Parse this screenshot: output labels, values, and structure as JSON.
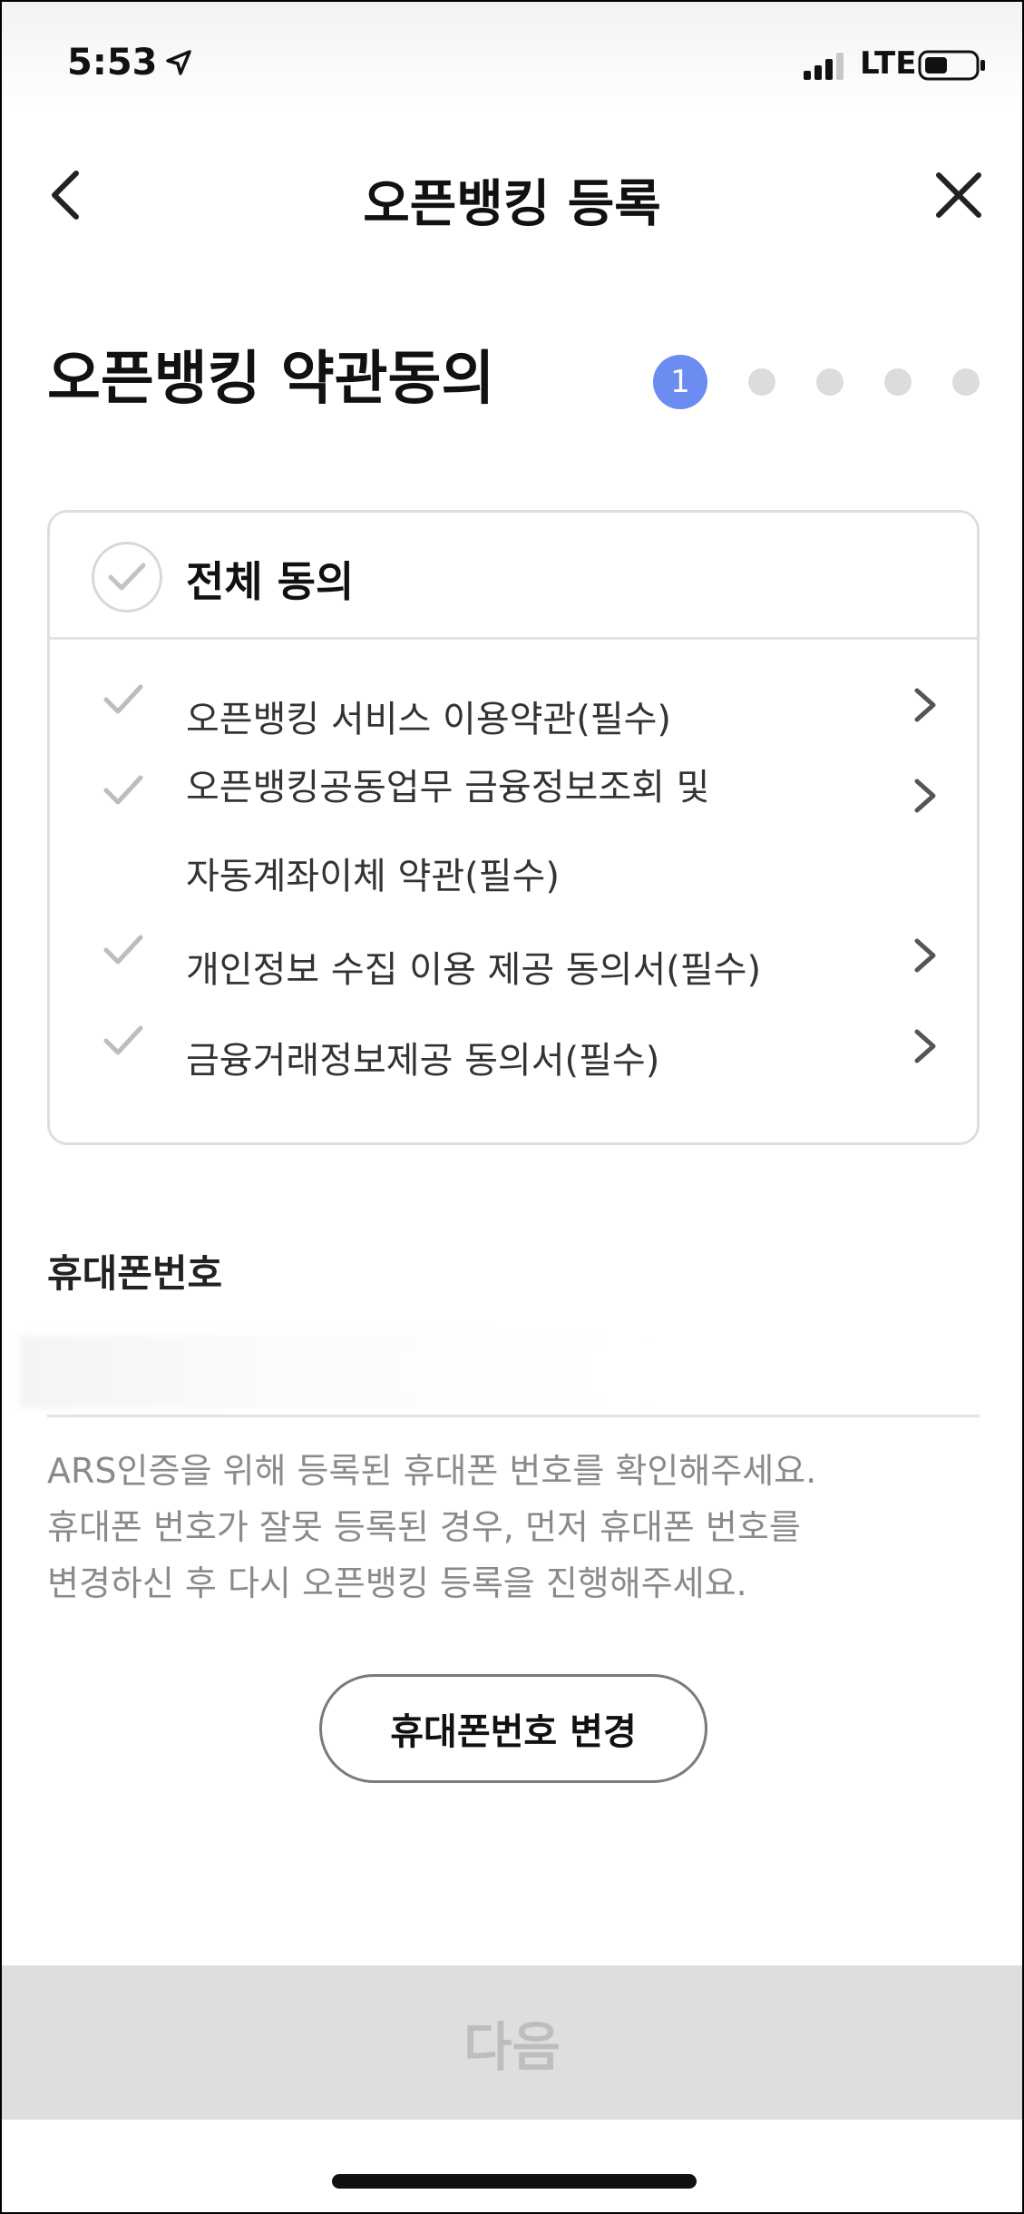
{
  "status_bar": {
    "time": "5:53",
    "network": "LTE"
  },
  "header": {
    "title": "오픈뱅킹 등록"
  },
  "section": {
    "title": "오픈뱅킹 약관동의",
    "current_step": "1",
    "total_steps": 5
  },
  "agreements": {
    "all_label": "전체 동의",
    "terms": [
      {
        "lines": [
          "오픈뱅킹 서비스 이용약관(필수)"
        ]
      },
      {
        "lines": [
          "오픈뱅킹공동업무 금융정보조회 및",
          "자동계좌이체 약관(필수)"
        ]
      },
      {
        "lines": [
          "개인정보 수집 이용 제공 동의서(필수)"
        ]
      },
      {
        "lines": [
          "금융거래정보제공 동의서(필수)"
        ]
      }
    ]
  },
  "phone": {
    "label": "휴대폰번호",
    "info_lines": [
      "ARS인증을 위해 등록된 휴대폰 번호를 확인해주세요.",
      "휴대폰 번호가 잘못 등록된 경우, 먼저 휴대폰 번호를",
      "변경하신 후 다시 오픈뱅킹 등록을 진행해주세요."
    ],
    "change_button": "휴대폰번호 변경"
  },
  "footer": {
    "next_button": "다음"
  },
  "colors": {
    "accent": "#6b8cf0",
    "next_disabled_bg": "#dedede",
    "next_disabled_text": "#bdbdbd"
  }
}
